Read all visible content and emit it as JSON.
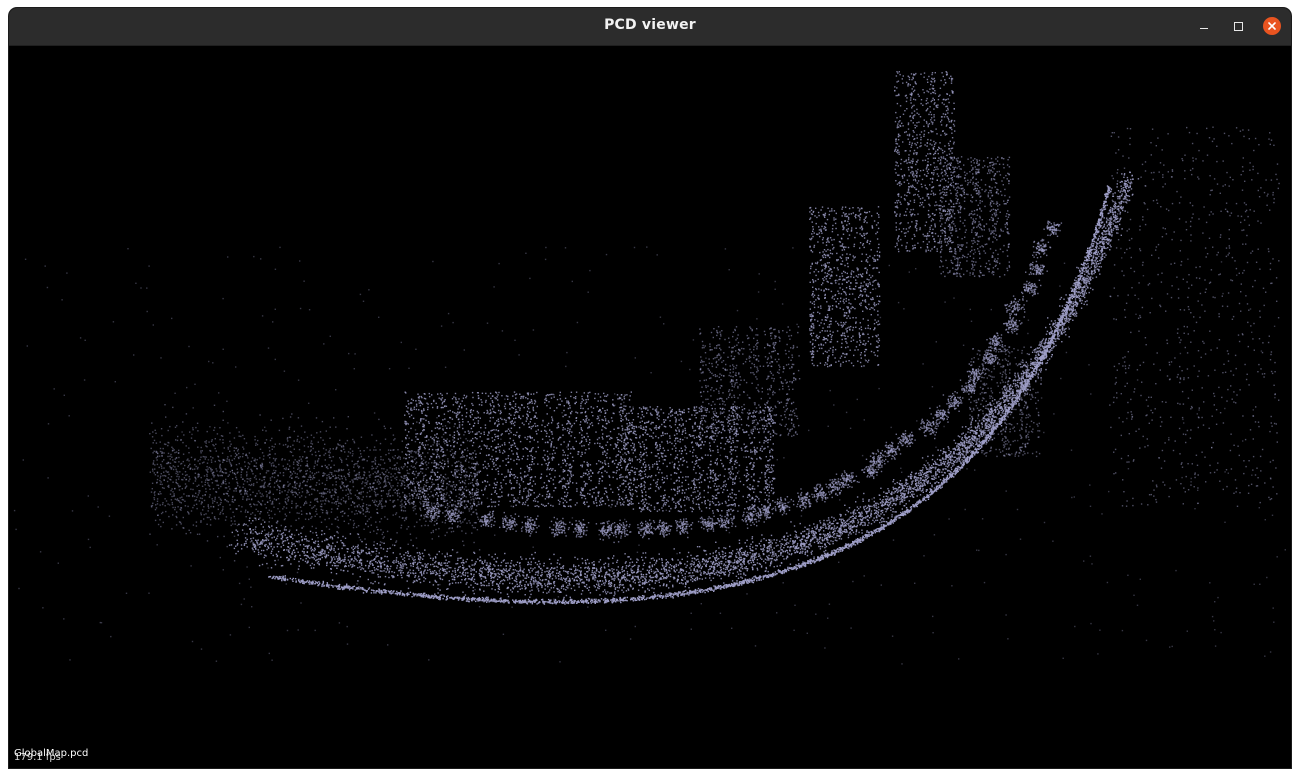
{
  "window": {
    "title": "PCD viewer"
  },
  "viewer": {
    "fps_text": "179.1 fps",
    "cloud_label": "GlobalMap.pcd",
    "point_color": "#9d9dc6",
    "background_color": "#000000"
  },
  "titlebar": {
    "close_color": "#e95420",
    "background_color": "#2c2c2c"
  }
}
